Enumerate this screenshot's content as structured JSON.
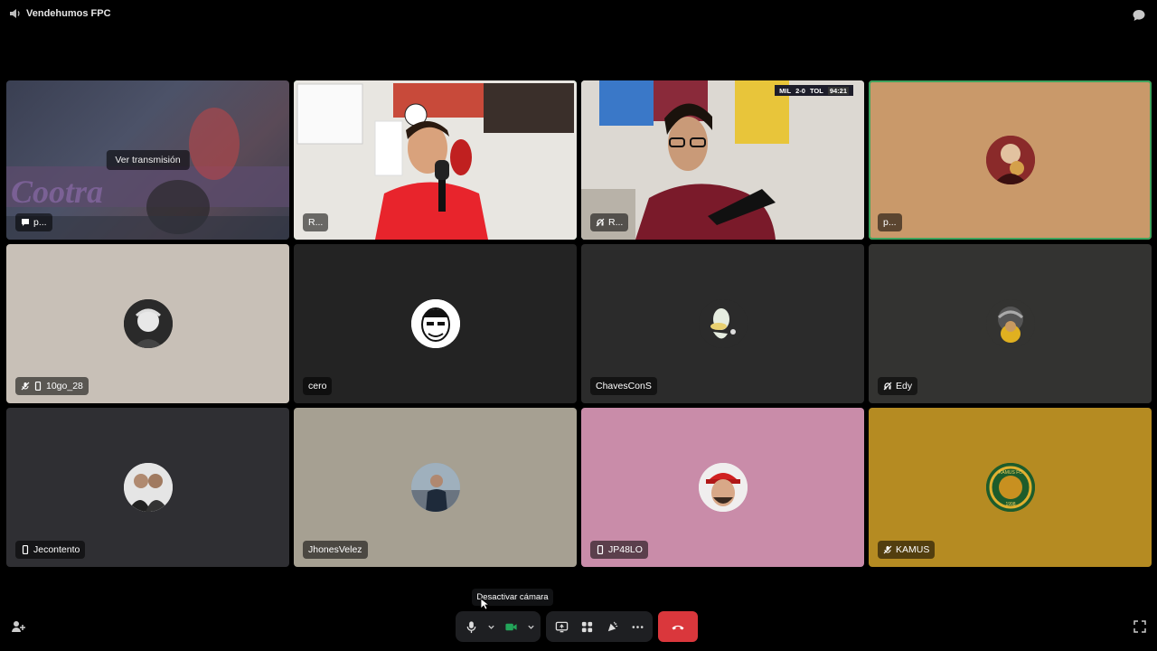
{
  "window": {
    "channel_name": "Vendehumos FPC"
  },
  "stream_tile": {
    "button_label": "Ver transmisión",
    "name": "p..."
  },
  "scoreboard": {
    "home": "MIL",
    "score": "2-0",
    "away": "TOL",
    "clock": "94:21"
  },
  "tiles": [
    {
      "name": "R..."
    },
    {
      "name": "R..."
    },
    {
      "name": "p..."
    },
    {
      "name": "10go_28"
    },
    {
      "name": "cero"
    },
    {
      "name": "ChavesConS"
    },
    {
      "name": "Edy"
    },
    {
      "name": "Jecontento"
    },
    {
      "name": "JhonesVelez"
    },
    {
      "name": "JP48LO"
    },
    {
      "name": "KAMUS"
    }
  ],
  "kamus_badge": {
    "top": "KAMUS FC",
    "year": "1998"
  },
  "tooltip": {
    "text": "Desactivar cámara"
  },
  "colors": {
    "speaking_border": "#3fa35d",
    "camera_on": "#23a55a",
    "hangup": "#da373c"
  },
  "icons": [
    "speaker-icon",
    "chat-icon",
    "mic-icon",
    "camera-icon",
    "screenshare-icon",
    "activities-icon",
    "soundboard-icon",
    "more-icon",
    "hangup-icon",
    "add-user-icon",
    "fullscreen-icon"
  ]
}
